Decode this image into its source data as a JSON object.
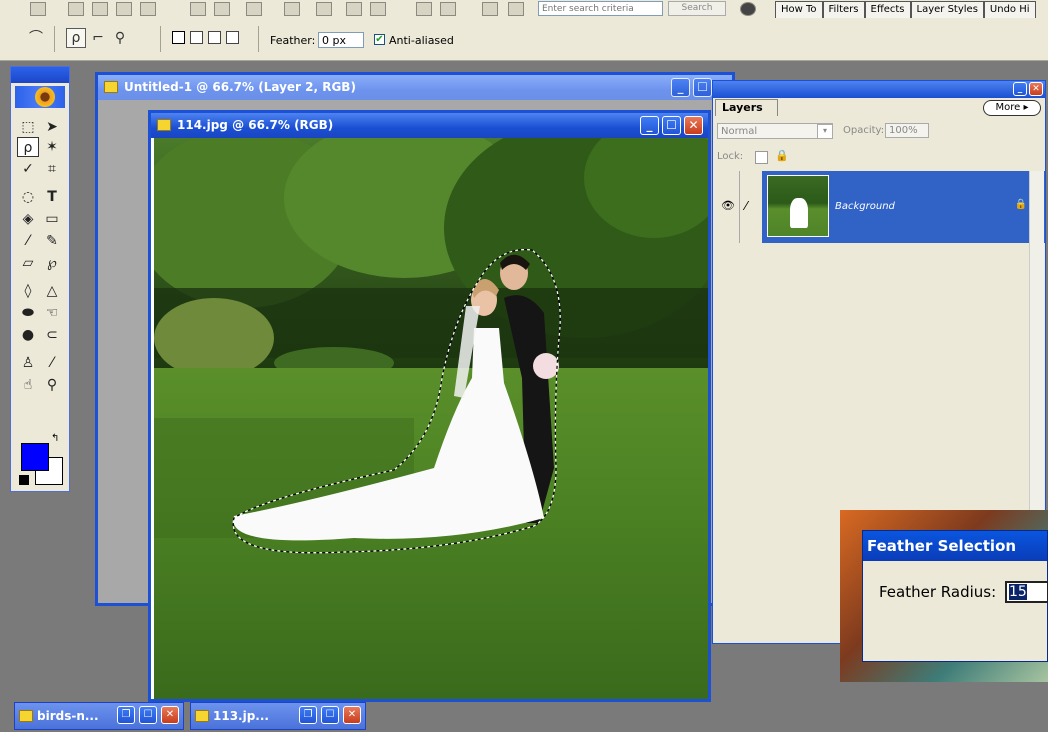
{
  "topbar": {
    "search_placeholder": "Enter search criteria",
    "search_button": "Search",
    "palette_tabs": [
      "How To",
      "Filters",
      "Effects",
      "Layer Styles",
      "Undo Hi"
    ]
  },
  "options": {
    "feather_label": "Feather:",
    "feather_value": "0 px",
    "antialiased_label": "Anti-aliased",
    "antialiased_checked": true
  },
  "windows": {
    "back_title": "Untitled-1 @ 66.7% (Layer 2, RGB)",
    "front_title": "114.jpg @ 66.7% (RGB)"
  },
  "layers": {
    "tab": "Layers",
    "more": "More",
    "blend_mode": "Normal",
    "opacity_label": "Opacity:",
    "opacity_value": "100%",
    "lock_label": "Lock:",
    "layer_name": "Background"
  },
  "feather_dialog": {
    "title": "Feather Selection",
    "radius_label": "Feather Radius:",
    "radius_value": "15"
  },
  "minimized": [
    {
      "title": "birds-n..."
    },
    {
      "title": "113.jp..."
    }
  ],
  "colors": {
    "foreground": "#0000ff",
    "background": "#ffffff",
    "xp_blue": "#1c51d6"
  }
}
